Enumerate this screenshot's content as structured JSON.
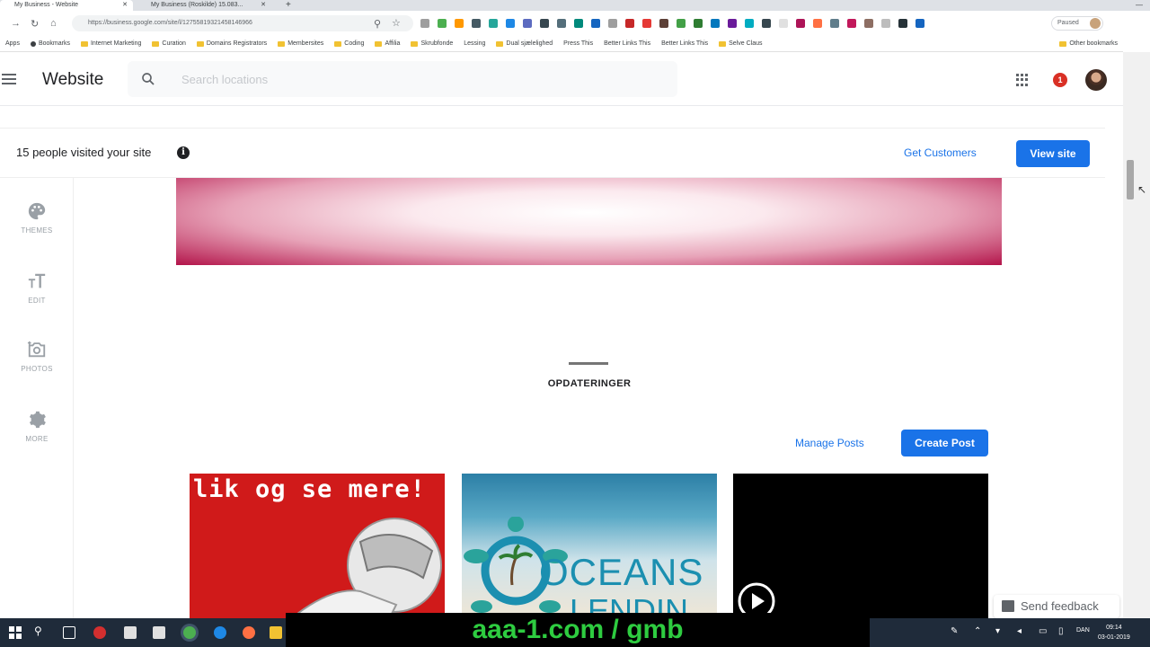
{
  "browser": {
    "tabs": [
      {
        "title": "My Business - Website",
        "active": true
      },
      {
        "title": "My Business (Roskilde) 15.083...",
        "active": false
      }
    ],
    "new_tab_label": "+",
    "url": "https://business.google.com/site/l/12755819321458146966",
    "bookmarks": [
      "Apps",
      "Bookmarks",
      "Internet Marketing",
      "Curation",
      "Domains Registrators",
      "Membersites",
      "Coding",
      "Affilia",
      "Skrubfonde",
      "Lessing",
      "Dual sjælelighed",
      "Press This",
      "Better Links This",
      "Better Links This",
      "Selve Claus"
    ],
    "other_bookmarks": "Other bookmarks",
    "paused_label": "Paused"
  },
  "header": {
    "title": "Website",
    "search_placeholder": "Search locations",
    "notifications_count": "1"
  },
  "visitors": {
    "text": "15 people visited your site",
    "get_customers": "Get Customers",
    "view_site": "View site"
  },
  "rail": {
    "themes": "THEMES",
    "edit": "EDIT",
    "photos": "PHOTOS",
    "more": "MORE"
  },
  "section": {
    "title": "OPDATERINGER",
    "manage_posts": "Manage Posts",
    "create_post": "Create Post"
  },
  "posts": {
    "post1_text": "lik og se mere!",
    "post2_text": "OCEANS",
    "post2_text2": "LENDIN"
  },
  "feedback": "Send feedback",
  "taskbar": {
    "watermark": "aaa-1.com / gmb",
    "lang": "DAN",
    "time": "09:14",
    "date": "03-01-2019"
  },
  "colors": {
    "accent": "#1a73e8",
    "banner_edge": "#b3144a",
    "watermark": "#2ecc40"
  }
}
